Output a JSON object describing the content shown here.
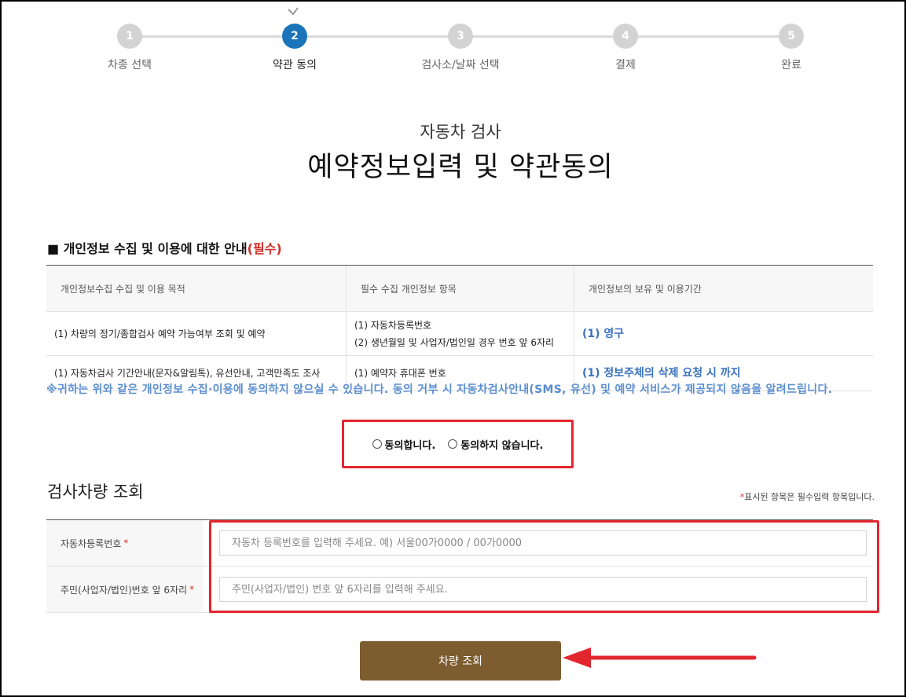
{
  "stepper": {
    "steps": [
      {
        "num": "1",
        "label": "차종 선택"
      },
      {
        "num": "2",
        "label": "약관 동의"
      },
      {
        "num": "3",
        "label": "검사소/날짜 선택"
      },
      {
        "num": "4",
        "label": "결제"
      },
      {
        "num": "5",
        "label": "완료"
      }
    ],
    "active_index": 1,
    "active_color": "#1b73b8"
  },
  "heading": {
    "subtitle": "자동차 검사",
    "title": "예약정보입력 및 약관동의"
  },
  "privacy": {
    "section_title": "■ 개인정보 수집 및 이용에 대한 안내",
    "required_tag": "(필수)",
    "table": {
      "headers": [
        "개인정보수집 수집 및 이용 목적",
        "필수 수집 개인정보 항목",
        "개인정보의 보유 및 이용기간"
      ],
      "rows": [
        {
          "purpose": "(1) 차량의 정기/종합검사 예약 가능여부 조회 및 예약",
          "items_line1": "(1) 자동차등록번호",
          "items_line2": "(2) 생년월일 및 사업자/법인일 경우 번호 앞 6자리",
          "period": "(1) 영구"
        },
        {
          "purpose": "(1) 자동차검사 기간안내(문자&알림톡), 유선안내, 고객만족도 조사",
          "items_line1": "(1) 예약자 휴대폰 번호",
          "items_line2": "",
          "period": "(1) 정보주체의 삭제 요청 시 까지"
        }
      ]
    },
    "notice": "※귀하는 위와 같은 개인정보 수집·이용에 동의하지 않으실 수 있습니다. 동의 거부 시 자동차검사안내(SMS, 유선) 및 예약 서비스가 제공되지 않음을 알려드립니다."
  },
  "consent": {
    "agree_label": "동의합니다.",
    "disagree_label": "동의하지 않습니다."
  },
  "vehicle": {
    "section_title": "검사차량 조회",
    "required_note_star": "*",
    "required_note": "표시된 항목은 필수입력 항목입니다.",
    "fields": [
      {
        "label": "자동차등록번호",
        "star": "*",
        "placeholder": "자동차 등록번호를 입력해 주세요. 예) 서울00가0000 / 00가0000",
        "value": ""
      },
      {
        "label": "주민(사업자/법인)번호 앞 6자리",
        "star": "*",
        "placeholder": "주민(사업자/법인) 번호 앞 6자리를 입력해 주세요.",
        "value": ""
      }
    ],
    "search_button": "차량 조회"
  },
  "colors": {
    "highlight": "#e2262e",
    "button": "#7d5c30",
    "notice_blue": "#5b8ed1"
  }
}
